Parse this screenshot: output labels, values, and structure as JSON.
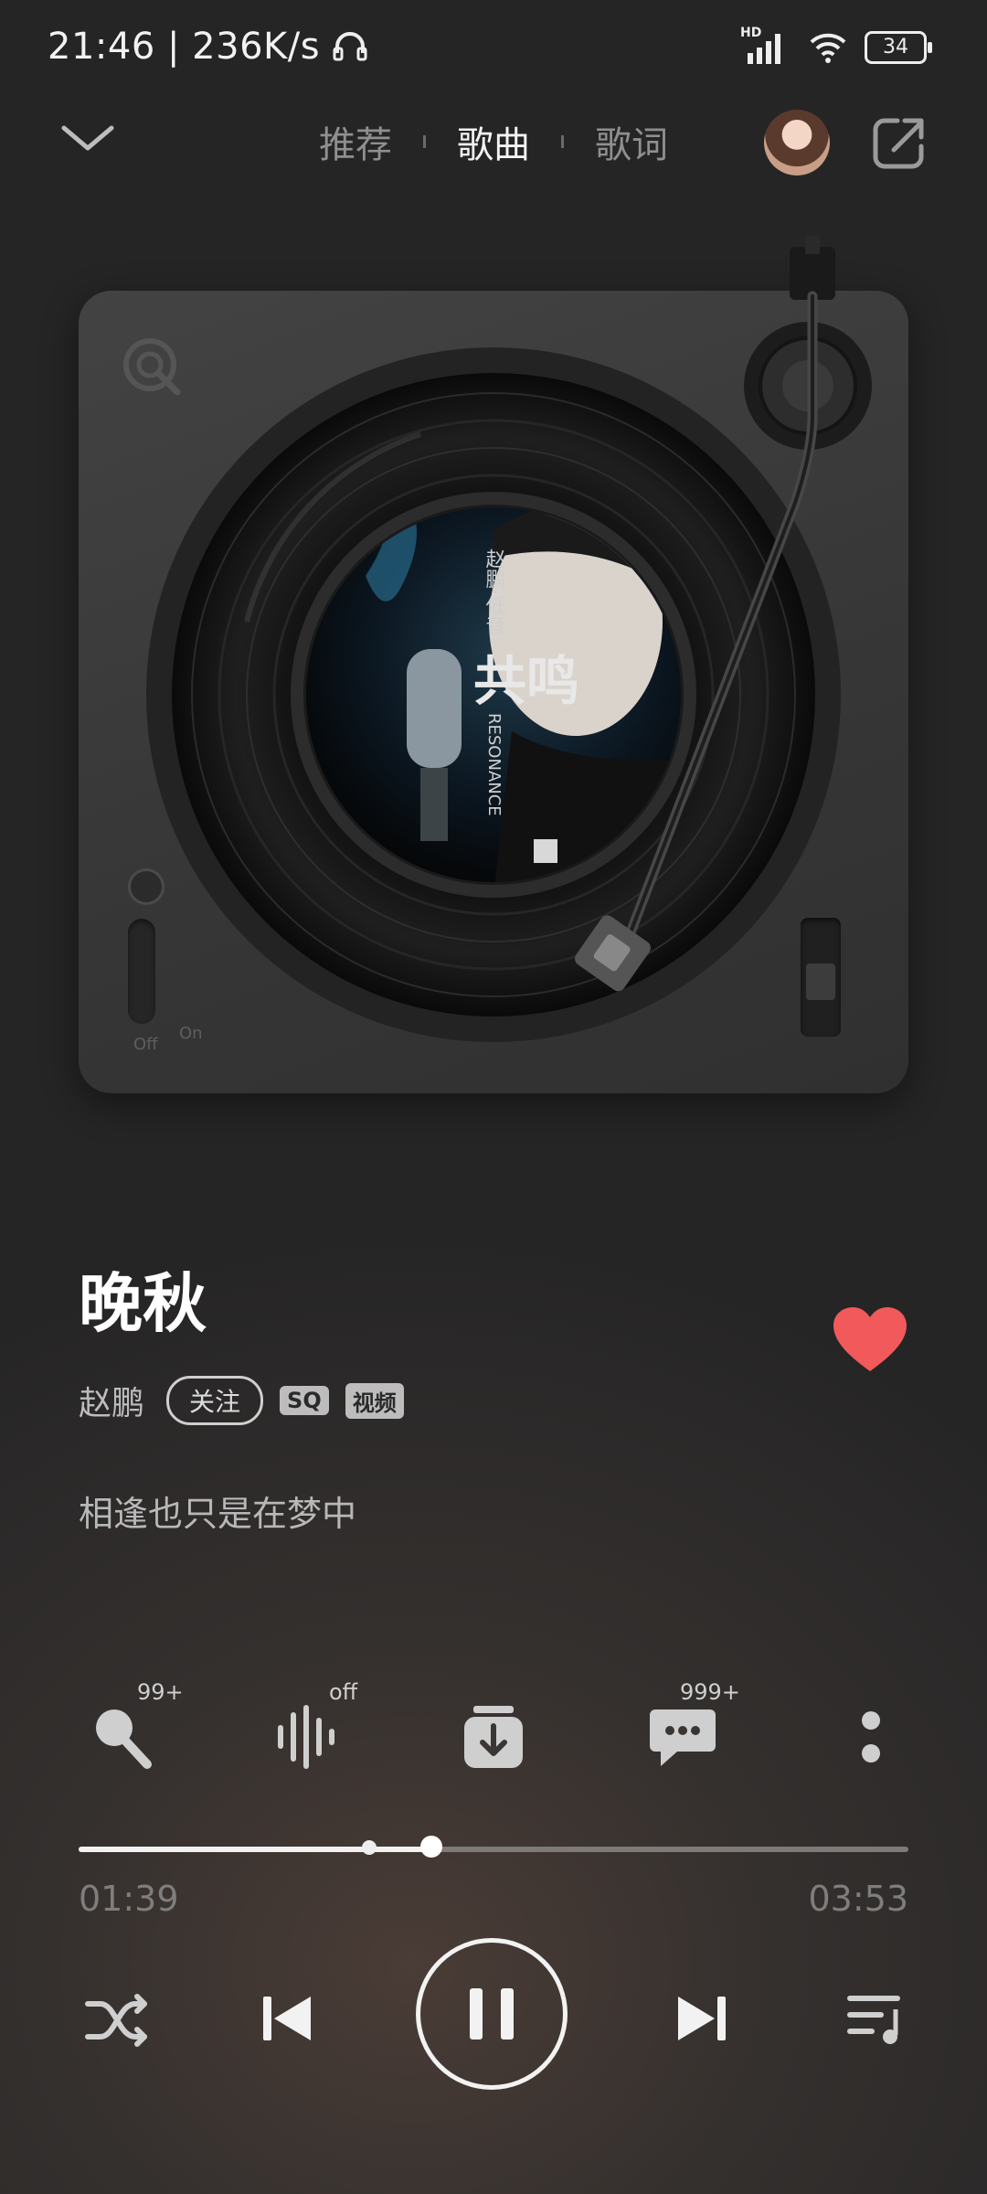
{
  "status_bar": {
    "time_speed": "21:46 | 236K/s",
    "network_badge": "HD",
    "battery": "34"
  },
  "header": {
    "tabs": [
      {
        "label": "推荐",
        "active": false
      },
      {
        "label": "歌曲",
        "active": true
      },
      {
        "label": "歌词",
        "active": false
      }
    ],
    "icons": [
      "chevron-down-icon",
      "share-icon"
    ]
  },
  "turntable": {
    "album_text_vertical": "赵鹏·低音",
    "album_title_glyph": "共鸣",
    "album_subtitle": "RESONANCE",
    "switch_off_label": "Off",
    "switch_on_label": "On"
  },
  "song": {
    "title": "晚秋",
    "artist": "赵鹏",
    "follow_label": "关注",
    "tags": [
      "SQ",
      "视频"
    ],
    "liked": true,
    "current_lyric": "相逢也只是在梦中"
  },
  "actions": [
    {
      "icon": "karaoke-mic-icon",
      "badge": "99+"
    },
    {
      "icon": "sound-effect-icon",
      "badge": "off"
    },
    {
      "icon": "download-icon",
      "badge": ""
    },
    {
      "icon": "comment-icon",
      "badge": "999+"
    },
    {
      "icon": "more-vertical-icon",
      "badge": ""
    }
  ],
  "playback": {
    "current_time": "01:39",
    "total_time": "03:53",
    "progress": 0.425,
    "buffer_mark": 0.35
  },
  "colors": {
    "like_red": "#f2595b",
    "accent_white": "#f2f2f2"
  }
}
